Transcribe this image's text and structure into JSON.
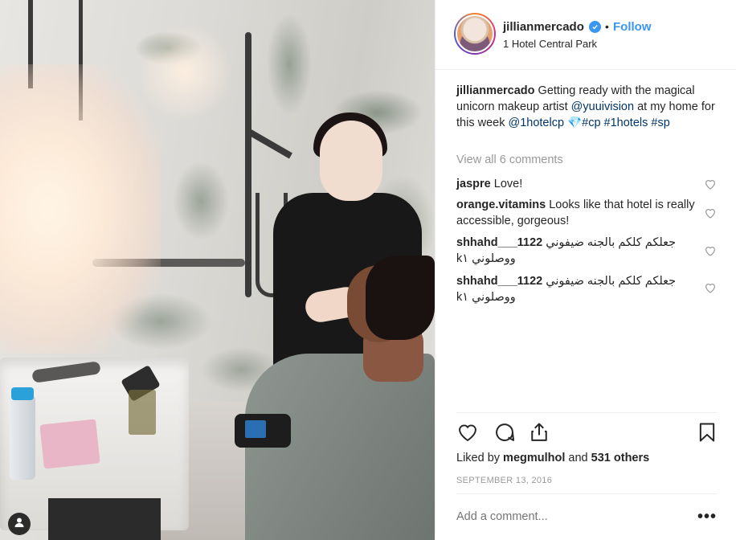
{
  "post": {
    "username": "jillianmercado",
    "follow_label": "Follow",
    "separator": "•",
    "location": "1 Hotel Central Park",
    "caption": {
      "username": "jillianmercado",
      "text_1": "Getting ready with the magical unicorn makeup artist",
      "mention_1": "@yuuivision",
      "text_2": "at my home for this week",
      "mention_2": "@1hotelcp",
      "emoji": "💎",
      "hashtag_1": "#cp",
      "hashtag_2": "#1hotels",
      "hashtag_3": "#sp"
    },
    "view_all_comments": "View all 6 comments",
    "comments": [
      {
        "user": "jaspre",
        "text": "Love!"
      },
      {
        "user": "orange.vitamins",
        "text": "Looks like that hotel is really accessible, gorgeous!"
      },
      {
        "user": "shhahd___1122",
        "text": "جعلكم كلكم بالجنه ضيفوني kووصلوني ١"
      },
      {
        "user": "shhahd___1122",
        "text": "جعلكم كلكم بالجنه ضيفوني kووصلوني ١"
      }
    ],
    "likes": {
      "prefix": "Liked by",
      "liker": "megmulhol",
      "and": "and",
      "others": "531 others"
    },
    "date": "SEPTEMBER 13, 2016",
    "add_comment_placeholder": "Add a comment...",
    "more_label": "•••"
  },
  "icons": {
    "verified": "verified-badge-icon",
    "heart": "heart-icon",
    "comment": "comment-icon",
    "share": "share-icon",
    "bookmark": "bookmark-icon",
    "tag": "user-tag-icon"
  },
  "colors": {
    "link_blue": "#3897f0",
    "mention_blue": "#003569",
    "text": "#262626",
    "muted": "#999999",
    "border": "#efefef"
  }
}
